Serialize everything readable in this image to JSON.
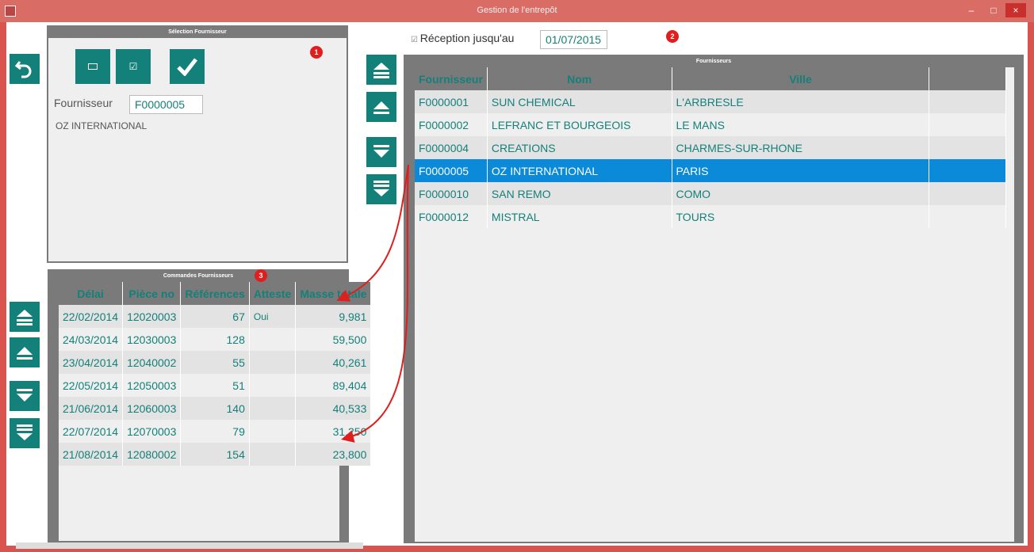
{
  "window": {
    "title": "Gestion de l'entrepôt",
    "buttons": [
      "–",
      "□",
      "×"
    ]
  },
  "left_panel": {
    "header": "Sélection Fournisseur",
    "badge": "1",
    "field_label": "Fournisseur",
    "field_value": "F0000005",
    "supplier_name": "OZ INTERNATIONAL"
  },
  "reception": {
    "checkbox_label": "Réception jusqu'au",
    "date": "01/07/2015",
    "badge": "2"
  },
  "suppliers_grid": {
    "header": "Fournisseurs",
    "columns": [
      "Fournisseur",
      "Nom",
      "Ville"
    ],
    "rows": [
      [
        "F0000001",
        "SUN CHEMICAL",
        "L'ARBRESLE"
      ],
      [
        "F0000002",
        "LEFRANC ET BOURGEOIS",
        "LE MANS"
      ],
      [
        "F0000004",
        "CREATIONS",
        "CHARMES-SUR-RHONE"
      ],
      [
        "F0000005",
        "OZ INTERNATIONAL",
        "PARIS"
      ],
      [
        "F0000010",
        "SAN REMO",
        "COMO"
      ],
      [
        "F0000012",
        "MISTRAL",
        "TOURS"
      ]
    ],
    "selected_index": 3
  },
  "orders_grid": {
    "header": "Commandes Fournisseurs",
    "badge": "3",
    "columns": [
      "Délai",
      "Pièce no",
      "Références",
      "Atteste",
      "Masse totale"
    ],
    "rows": [
      [
        "22/02/2014",
        "12020003",
        "67",
        "Oui",
        "9,981"
      ],
      [
        "24/03/2014",
        "12030003",
        "128",
        "",
        "59,500"
      ],
      [
        "23/04/2014",
        "12040002",
        "55",
        "",
        "40,261"
      ],
      [
        "22/05/2014",
        "12050003",
        "51",
        "",
        "89,404"
      ],
      [
        "21/06/2014",
        "12060003",
        "140",
        "",
        "40,533"
      ],
      [
        "22/07/2014",
        "12070003",
        "79",
        "",
        "31,250"
      ],
      [
        "21/08/2014",
        "12080002",
        "154",
        "",
        "23,800"
      ]
    ]
  },
  "colors": {
    "teal": "#14807a",
    "selection": "#0a8ad9",
    "frame": "#d9534f",
    "badge": "#e01e1e"
  }
}
